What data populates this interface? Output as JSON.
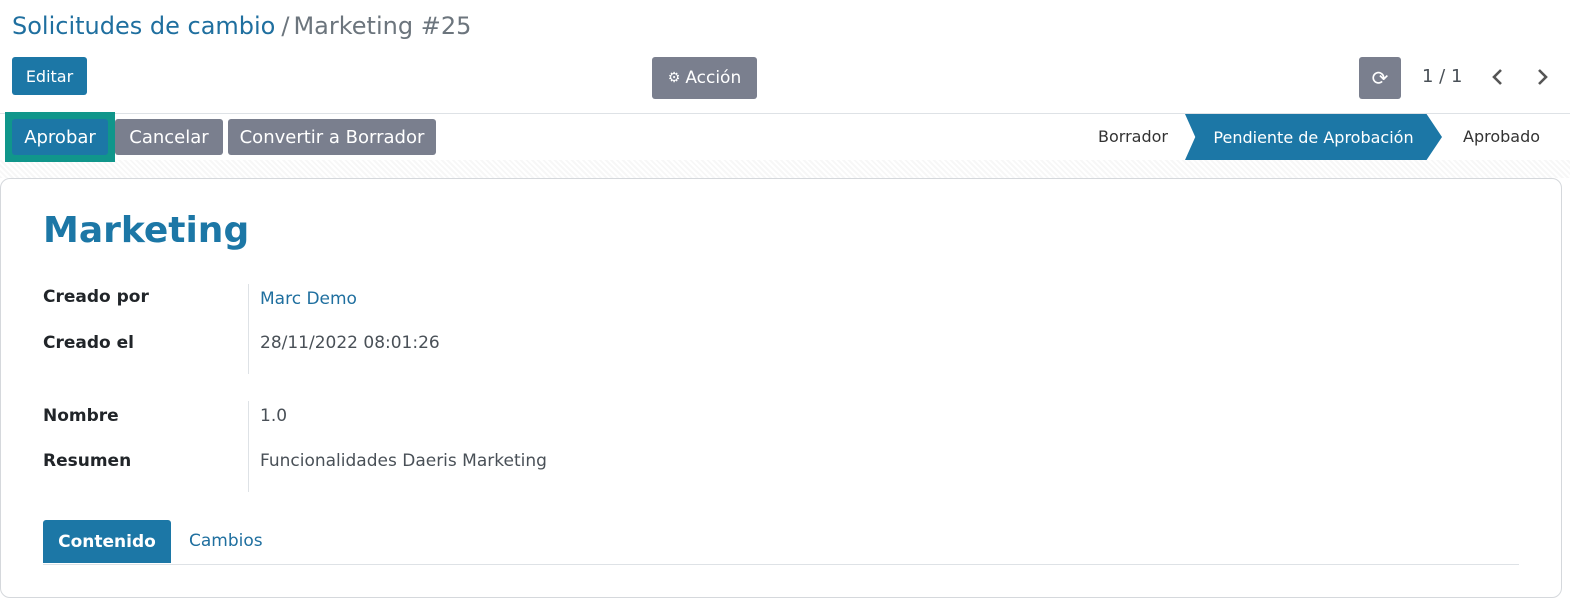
{
  "breadcrumb": {
    "parent": "Solicitudes de cambio",
    "separator": "/",
    "current": "Marketing #25"
  },
  "toolbar": {
    "edit_label": "Editar",
    "action_label": "Acción",
    "pager": "1 / 1"
  },
  "statusbar": {
    "buttons": {
      "approve": "Aprobar",
      "cancel": "Cancelar",
      "draft": "Convertir a Borrador"
    },
    "stages": {
      "draft": "Borrador",
      "pending": "Pendiente de Aprobación",
      "approved": "Aprobado"
    },
    "current_stage": "Pendiente de Aprobación"
  },
  "record": {
    "title": "Marketing",
    "fields": {
      "created_by": {
        "label": "Creado por",
        "value": "Marc Demo"
      },
      "created_on": {
        "label": "Creado el",
        "value": "28/11/2022 08:01:26"
      },
      "name": {
        "label": "Nombre",
        "value": "1.0"
      },
      "summary": {
        "label": "Resumen",
        "value": "Funcionalidades Daeris Marketing"
      }
    }
  },
  "tabs": {
    "content": "Contenido",
    "changes": "Cambios",
    "active": "Contenido"
  },
  "icons": {
    "action": "gear-icon",
    "refresh": "refresh-icon",
    "prev": "chevron-left-icon",
    "next": "chevron-right-icon"
  },
  "colors": {
    "primary": "#1c77a6",
    "secondary": "#7a7f8e",
    "highlight": "#10968b",
    "link": "#1f6f9f"
  }
}
